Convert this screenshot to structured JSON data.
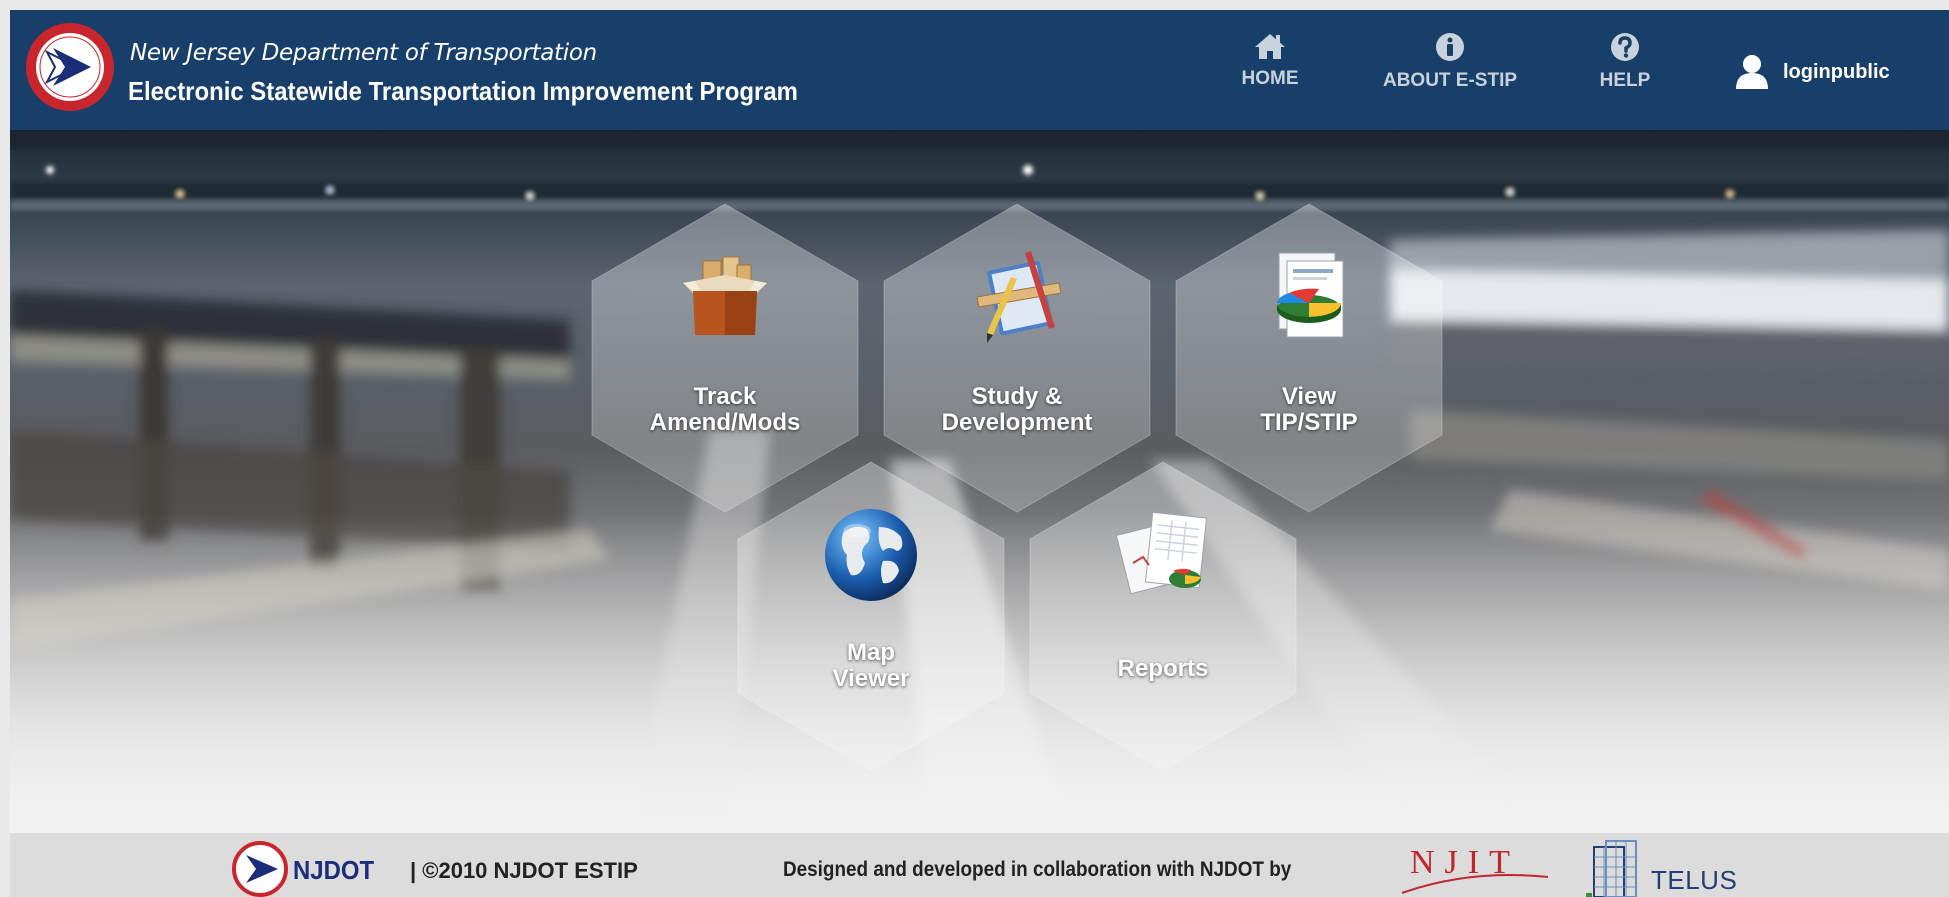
{
  "header": {
    "agency": "New Jersey Department of Transportation",
    "program": "Electronic Statewide Transportation Improvement Program",
    "seal_icon": "njdot-seal-icon",
    "nav": [
      {
        "label": "HOME",
        "icon": "home-icon"
      },
      {
        "label": "ABOUT E-STIP",
        "icon": "info-icon"
      },
      {
        "label": "HELP",
        "icon": "help-icon"
      }
    ],
    "user": {
      "name": "loginpublic",
      "icon": "user-icon"
    }
  },
  "tiles": [
    {
      "lines": [
        "Track",
        "Amend/Mods"
      ],
      "icon": "box-icon"
    },
    {
      "lines": [
        "Study &",
        "Development"
      ],
      "icon": "drafting-tools-icon"
    },
    {
      "lines": [
        "View",
        "TIP/STIP"
      ],
      "icon": "pie-chart-document-icon"
    },
    {
      "lines": [
        "Map",
        "Viewer"
      ],
      "icon": "globe-icon"
    },
    {
      "lines": [
        "Reports"
      ],
      "icon": "report-pages-icon"
    }
  ],
  "footer": {
    "njdot": "NJDOT",
    "copyright": "| ©2010 NJDOT ESTIP",
    "credit": "Designed and developed in collaboration with NJDOT by",
    "partner1": "NJIT",
    "partner2": "TELUS"
  },
  "colors": {
    "header_bg": "#183f69",
    "nav_text": "#c9d2dc",
    "footer_bg": "#dcdcdc",
    "njdot_blue": "#1b2c7a",
    "njit_red": "#c0272d",
    "telus_blue": "#243f73"
  }
}
